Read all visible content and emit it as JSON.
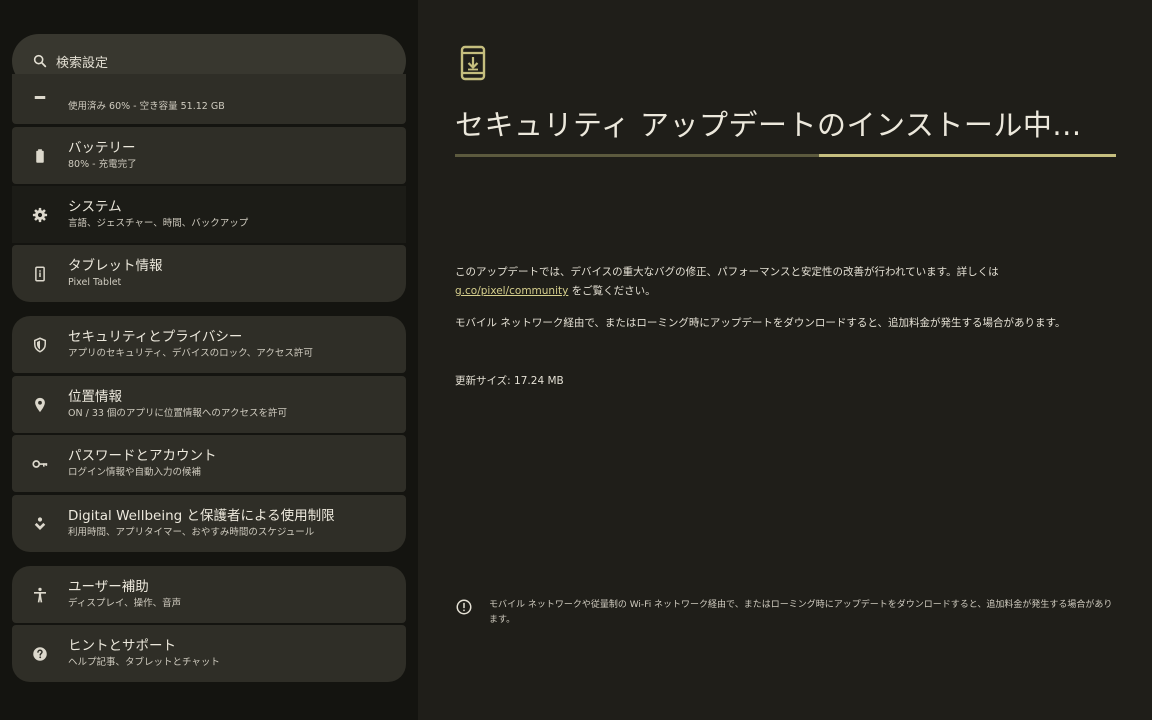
{
  "search": {
    "placeholder": "検索設定"
  },
  "sidebar": {
    "items": [
      {
        "title": "",
        "sub": "使用済み 60% - 空き容量 51.12 GB",
        "icon": "storage-icon"
      },
      {
        "title": "バッテリー",
        "sub": "80% - 充電完了",
        "icon": "battery-icon"
      },
      {
        "title": "システム",
        "sub": "言語、ジェスチャー、時間、バックアップ",
        "icon": "gear-icon"
      },
      {
        "title": "タブレット情報",
        "sub": "Pixel Tablet",
        "icon": "tablet-info-icon"
      },
      {
        "title": "セキュリティとプライバシー",
        "sub": "アプリのセキュリティ、デバイスのロック、アクセス許可",
        "icon": "shield-icon"
      },
      {
        "title": "位置情報",
        "sub": "ON / 33 個のアプリに位置情報へのアクセスを許可",
        "icon": "location-pin-icon"
      },
      {
        "title": "パスワードとアカウント",
        "sub": "ログイン情報や自動入力の候補",
        "icon": "key-icon"
      },
      {
        "title": "Digital Wellbeing と保護者による使用制限",
        "sub": "利用時間、アプリタイマー、おやすみ時間のスケジュール",
        "icon": "wellbeing-icon"
      },
      {
        "title": "ユーザー補助",
        "sub": "ディスプレイ、操作、音声",
        "icon": "accessibility-icon"
      },
      {
        "title": "ヒントとサポート",
        "sub": "ヘルプ記事、タブレットとチャット",
        "icon": "help-icon"
      }
    ]
  },
  "main": {
    "heading": "セキュリティ アップデートのインストール中...",
    "progress": 0.45,
    "para1_pre": "このアップデートでは、デバイスの重大なバグの修正、パフォーマンスと安定性の改善が行われています。詳しくは ",
    "para1_link": "g.co/pixel/community",
    "para1_post": " をご覧ください。",
    "para2": "モバイル ネットワーク経由で、またはローミング時にアップデートをダウンロードすると、追加料金が発生する場合があります。",
    "size_label": "更新サイズ: 17.24 MB",
    "note": "モバイル ネットワークや従量制の Wi-Fi ネットワーク経由で、またはローミング時にアップデートをダウンロードすると、追加料金が発生する場合があります。"
  },
  "colors": {
    "accent": "#c5be7e",
    "track": "#5c5a3e",
    "card": "#2f2e27",
    "pane": "#1f1e19"
  }
}
